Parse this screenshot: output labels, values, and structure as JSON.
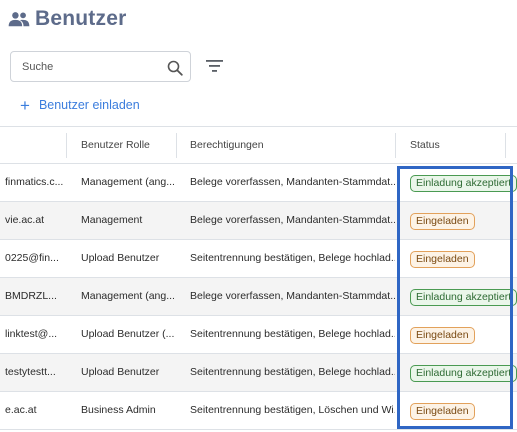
{
  "header": {
    "title": "Benutzer",
    "icon": "users-icon",
    "title_color": "#5d6b8a"
  },
  "search": {
    "placeholder": "Suche",
    "value": "",
    "icon": "search-icon"
  },
  "filter": {
    "icon": "filter-icon"
  },
  "invite": {
    "icon": "plus-icon",
    "label": "Benutzer einladen",
    "color": "#3b7ddd"
  },
  "table": {
    "columns": {
      "role": "Benutzer Rolle",
      "permissions": "Berechtigungen",
      "status": "Status"
    },
    "rows": [
      {
        "email": "finmatics.c...",
        "role": "Management (ang...",
        "permissions": "Belege vorerfassen, Mandanten-Stammdat...",
        "status": "Einladung akzeptiert",
        "status_kind": "accepted"
      },
      {
        "email": "vie.ac.at",
        "role": "Management",
        "permissions": "Belege vorerfassen, Mandanten-Stammdat...",
        "status": "Eingeladen",
        "status_kind": "invited"
      },
      {
        "email": "0225@fin...",
        "role": "Upload Benutzer",
        "permissions": "Seitentrennung bestätigen, Belege hochlad...",
        "status": "Eingeladen",
        "status_kind": "invited"
      },
      {
        "email": "BMDRZL...",
        "role": "Management (ang...",
        "permissions": "Belege vorerfassen, Mandanten-Stammdat...",
        "status": "Einladung akzeptiert",
        "status_kind": "accepted"
      },
      {
        "email": "linktest@...",
        "role": "Upload Benutzer (...",
        "permissions": "Seitentrennung bestätigen, Belege hochlad...",
        "status": "Eingeladen",
        "status_kind": "invited"
      },
      {
        "email": "testytestt...",
        "role": "Upload Benutzer",
        "permissions": "Seitentrennung bestätigen, Belege hochlad...",
        "status": "Einladung akzeptiert",
        "status_kind": "accepted"
      },
      {
        "email": "e.ac.at",
        "role": "Business Admin",
        "permissions": "Seitentrennung bestätigen, Löschen und Wi...",
        "status": "Eingeladen",
        "status_kind": "invited"
      }
    ]
  },
  "colors": {
    "accepted_border": "#4a9a52",
    "invited_border": "#e2a15b",
    "highlight": "#2f66c4"
  }
}
